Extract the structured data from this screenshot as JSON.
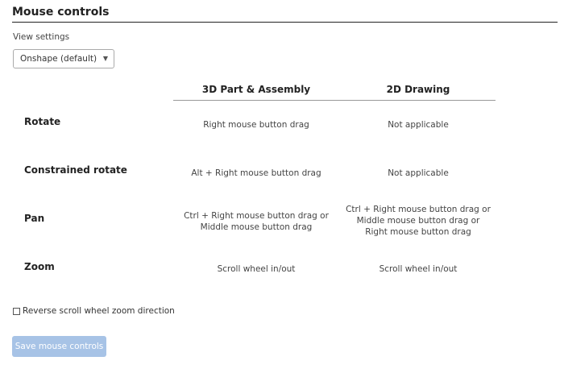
{
  "section": {
    "title": "Mouse controls"
  },
  "view_settings": {
    "label": "View settings",
    "selected": "Onshape (default)",
    "caret_icon": "chevron-down-icon"
  },
  "table": {
    "columns": [
      "3D Part & Assembly",
      "2D Drawing"
    ],
    "rows": [
      {
        "action": "Rotate",
        "part_assembly": "Right mouse button drag",
        "drawing": "Not applicable"
      },
      {
        "action": "Constrained rotate",
        "part_assembly": "Alt + Right mouse button drag",
        "drawing": "Not applicable"
      },
      {
        "action": "Pan",
        "part_assembly_lines": [
          "Ctrl + Right mouse button drag or",
          "Middle mouse button drag"
        ],
        "drawing_lines": [
          "Ctrl + Right mouse button drag or",
          "Middle mouse button drag or",
          "Right mouse button drag"
        ]
      },
      {
        "action": "Zoom",
        "part_assembly": "Scroll wheel in/out",
        "drawing": "Scroll wheel in/out"
      }
    ]
  },
  "reverse_scroll": {
    "label": "Reverse scroll wheel zoom direction",
    "checked": false
  },
  "save_button": {
    "label": "Save mouse controls",
    "disabled": true
  }
}
